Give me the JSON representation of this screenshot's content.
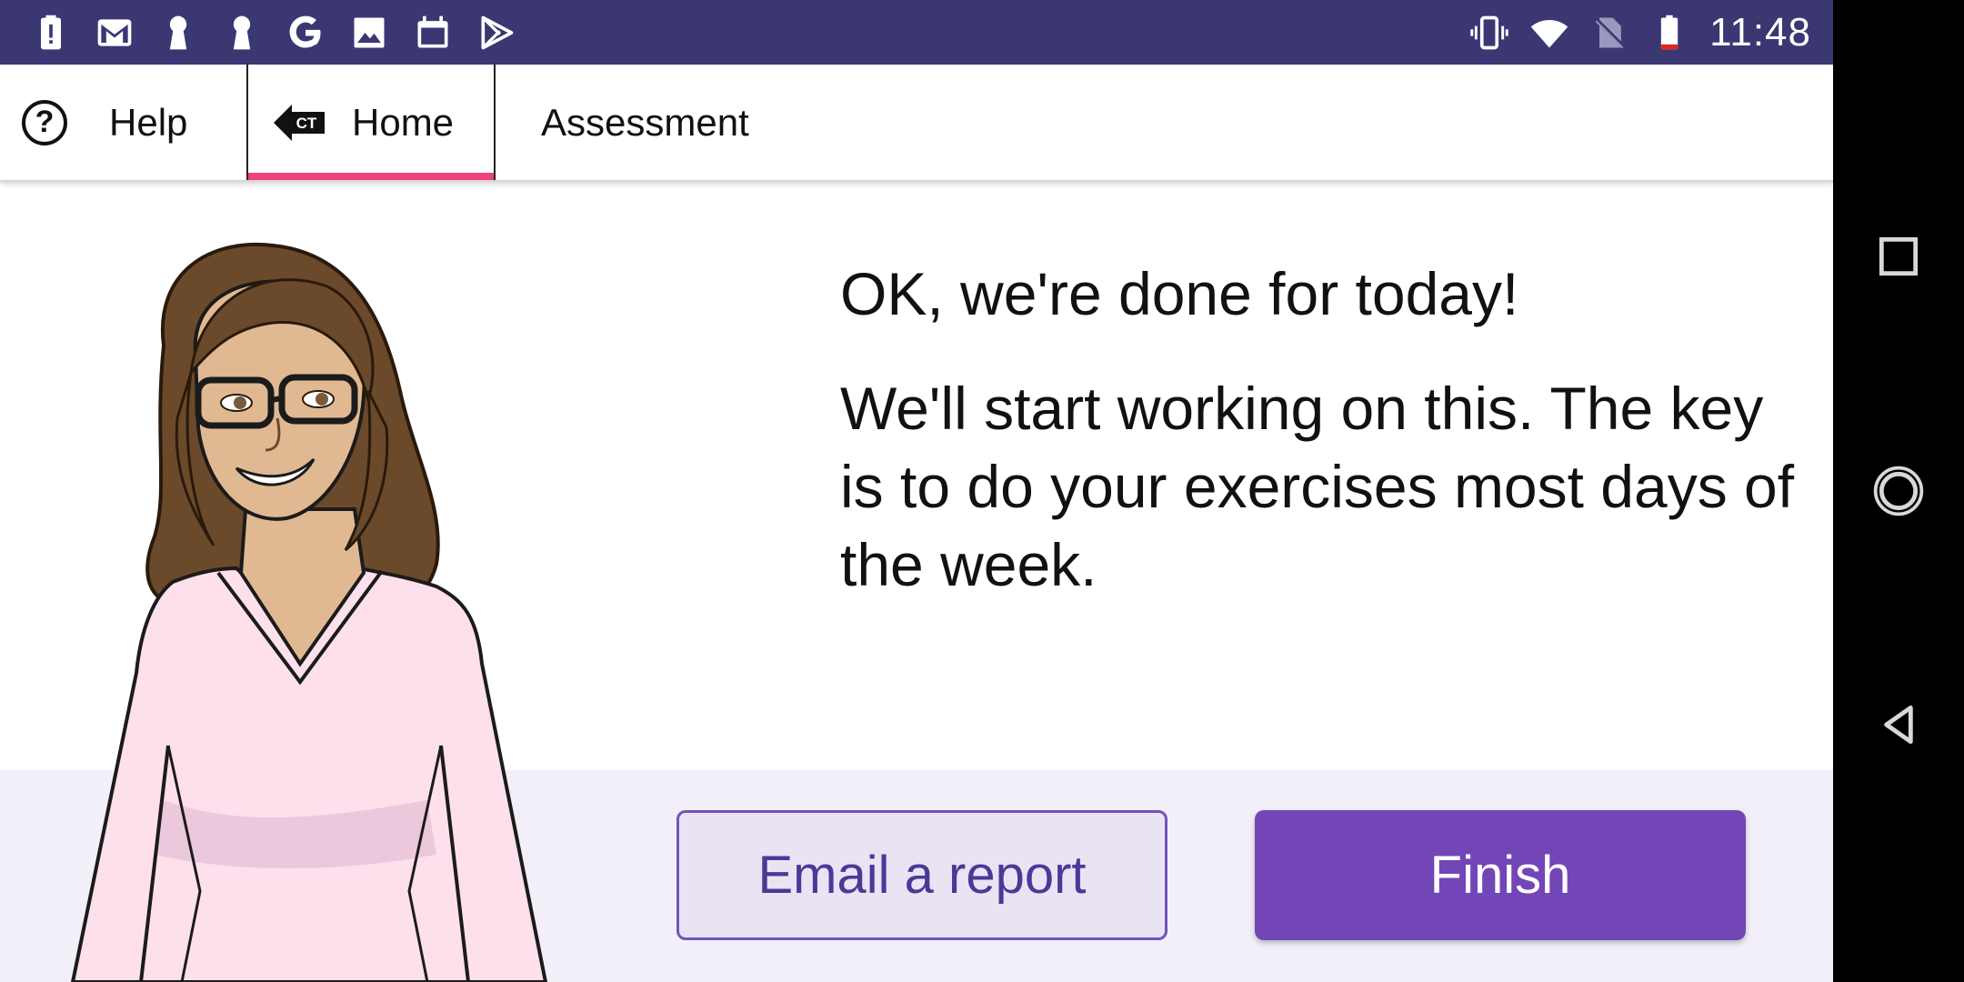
{
  "status_bar": {
    "left_icons": [
      "alert-battery-icon",
      "gmail-icon",
      "keyhole-icon",
      "keyhole-icon-2",
      "google-icon",
      "image-icon",
      "calendar-app-icon",
      "play-store-icon"
    ],
    "right_icons": [
      "vibrate-icon",
      "wifi-icon",
      "no-sim-icon",
      "battery-low-icon"
    ],
    "time": "11:48"
  },
  "tabs": {
    "help": "Help",
    "home": "Home",
    "home_badge": "CT",
    "assessment": "Assessment"
  },
  "message": {
    "line1": "OK, we're done for today!",
    "line2": "We'll start working on this. The key is to do your exercises most days of the week."
  },
  "buttons": {
    "email": "Email a report",
    "finish": "Finish"
  },
  "colors": {
    "status_bar": "#3a3772",
    "accent_tab": "#f0417e",
    "primary": "#7346b7",
    "secondary_bg": "#e9e3f4",
    "lower_band": "#f2eff8"
  }
}
